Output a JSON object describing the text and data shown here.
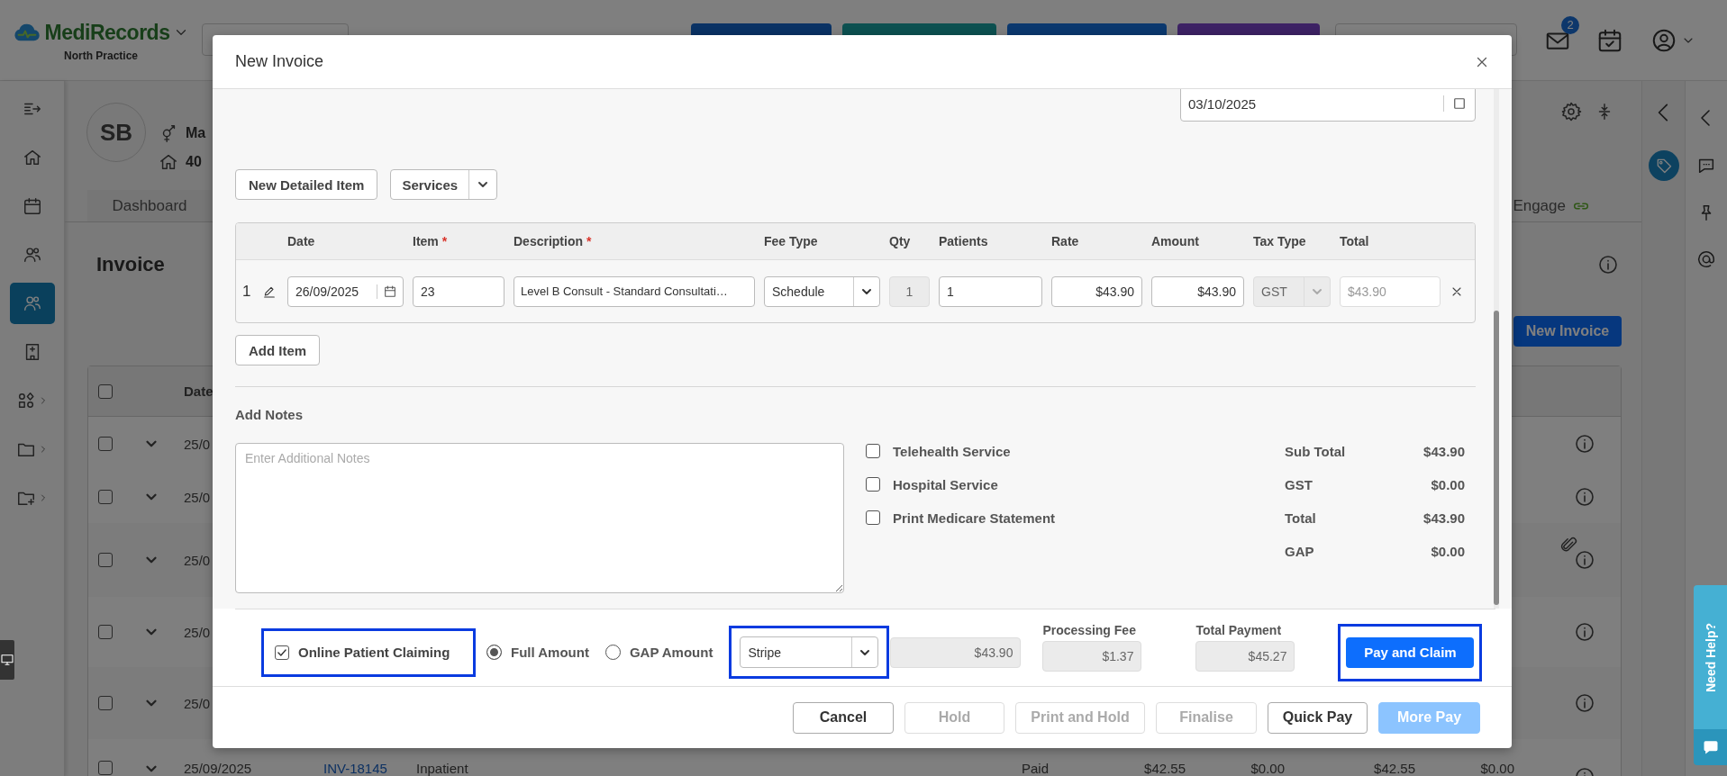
{
  "app_header": {
    "brand": "MediRecords",
    "practice": "North Practice",
    "mail_badge": "2"
  },
  "sidebar": {
    "items": [
      {
        "selected": false,
        "has_submenu": false
      },
      {
        "selected": false,
        "has_submenu": false
      },
      {
        "selected": false,
        "has_submenu": false
      },
      {
        "selected": false,
        "has_submenu": false
      },
      {
        "selected": true,
        "has_submenu": false
      },
      {
        "selected": false,
        "has_submenu": false
      },
      {
        "selected": false,
        "has_submenu": true
      },
      {
        "selected": false,
        "has_submenu": true
      },
      {
        "selected": false,
        "has_submenu": true
      }
    ]
  },
  "patient": {
    "initials": "SB",
    "line_1": "Ma",
    "line_2": "40"
  },
  "tabs": [
    {
      "label": "Dashboard",
      "selected": true,
      "linked": false
    },
    {
      "label": "Engage",
      "selected": false,
      "linked": true
    }
  ],
  "page_title": "Invoice",
  "new_invoice_button": "New Invoice",
  "invoice_table": {
    "all_checked": false,
    "columns": [
      "Date"
    ],
    "rows": [
      {
        "checked": false,
        "date": "25/0",
        "attachment": false
      },
      {
        "checked": false,
        "date": "25/0",
        "attachment": false
      },
      {
        "checked": false,
        "date": "25/0",
        "attachment": true
      },
      {
        "checked": false,
        "date": "25/0",
        "attachment": false
      },
      {
        "checked": false,
        "date": "25/0",
        "attachment": false
      },
      {
        "checked": false,
        "date": "25/09/2025",
        "number": "INV-18145",
        "type": "Inpatient",
        "status": "Paid",
        "amounts": [
          "$42.55",
          "$0.00",
          "$42.55",
          "$0.00"
        ],
        "attachment": false
      }
    ]
  },
  "help_tab": "Need Help?",
  "modal": {
    "title": "New Invoice",
    "invoice_date": "03/10/2025",
    "toolbar": {
      "new_detailed_item": "New Detailed Item",
      "services": "Services"
    },
    "items": {
      "columns": [
        {
          "label": "Date"
        },
        {
          "label": "Item",
          "required_mark": "*"
        },
        {
          "label": "Description",
          "required_mark": "*"
        },
        {
          "label": "Fee Type"
        },
        {
          "label": "Qty"
        },
        {
          "label": "Patients"
        },
        {
          "label": "Rate"
        },
        {
          "label": "Amount"
        },
        {
          "label": "Tax Type"
        },
        {
          "label": "Total"
        }
      ],
      "rows": [
        {
          "number": "1",
          "date": "26/09/2025",
          "item": "23",
          "description": "Level B Consult - Standard Consultati…",
          "fee_type": "Schedule",
          "qty": "1",
          "patients": "1",
          "rate": "$43.90",
          "amount": "$43.90",
          "tax_type": "GST",
          "total": "$43.90"
        }
      ]
    },
    "add_item": "Add Item",
    "notes_label": "Add Notes",
    "notes_placeholder": "Enter Additional Notes",
    "options": [
      {
        "label": "Telehealth Service",
        "checked": false
      },
      {
        "label": "Hospital Service",
        "checked": false
      },
      {
        "label": "Print Medicare Statement",
        "checked": false
      }
    ],
    "totals": [
      {
        "label": "Sub Total",
        "value": "$43.90"
      },
      {
        "label": "GST",
        "value": "$0.00"
      },
      {
        "label": "Total",
        "value": "$43.90"
      },
      {
        "label": "GAP",
        "value": "$0.00"
      }
    ],
    "payment": {
      "online_claiming": {
        "label": "Online Patient Claiming",
        "checked": true,
        "highlighted": true
      },
      "amount_options": [
        {
          "label": "Full Amount",
          "selected": true
        },
        {
          "label": "GAP Amount",
          "selected": false
        }
      ],
      "method": {
        "value": "Stripe",
        "highlighted": true
      },
      "amount": "$43.90",
      "processing_fee": {
        "label": "Processing Fee",
        "value": "$1.37"
      },
      "total_payment": {
        "label": "Total Payment",
        "value": "$45.27"
      },
      "pay_button": {
        "label": "Pay and Claim",
        "highlighted": true
      }
    },
    "footer_buttons": [
      {
        "label": "Cancel",
        "disabled": false,
        "kind": "default"
      },
      {
        "label": "Hold",
        "disabled": true,
        "kind": "default"
      },
      {
        "label": "Print and Hold",
        "disabled": true,
        "kind": "default"
      },
      {
        "label": "Finalise",
        "disabled": true,
        "kind": "default"
      },
      {
        "label": "Quick Pay",
        "disabled": false,
        "kind": "default"
      },
      {
        "label": "More Pay",
        "disabled": true,
        "kind": "primary"
      }
    ]
  }
}
